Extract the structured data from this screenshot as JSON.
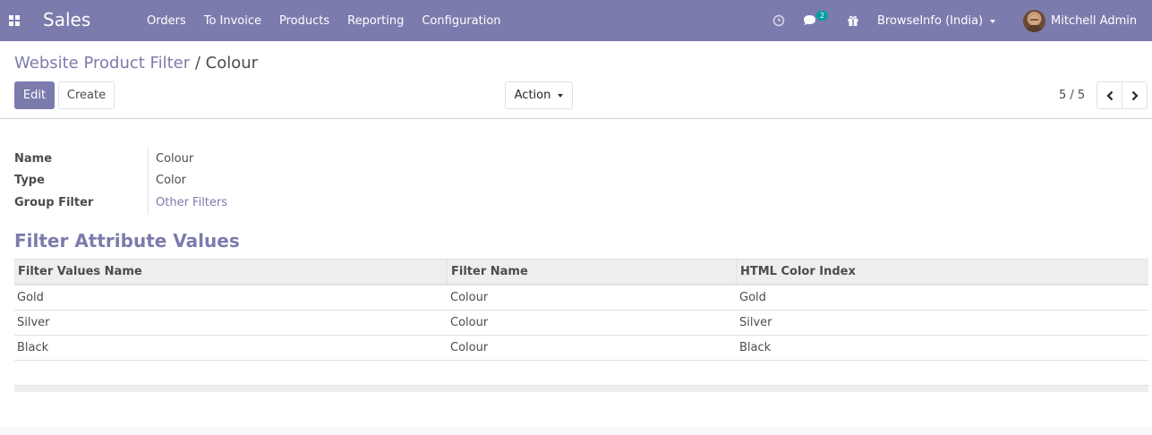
{
  "navbar": {
    "app_name": "Sales",
    "menu": [
      "Orders",
      "To Invoice",
      "Products",
      "Reporting",
      "Configuration"
    ],
    "messages_count": "2",
    "company": "BrowseInfo (India)",
    "user": "Mitchell Admin",
    "bg_color": "#7c7bad"
  },
  "breadcrumb": {
    "parent": "Website Product Filter",
    "separator": "/",
    "current": "Colour"
  },
  "buttons": {
    "edit": "Edit",
    "create": "Create",
    "action": "Action"
  },
  "pager": {
    "value": "5 / 5"
  },
  "form": {
    "fields": [
      {
        "label": "Name",
        "value": "Colour"
      },
      {
        "label": "Type",
        "value": "Color"
      },
      {
        "label": "Group Filter",
        "value": "Other Filters"
      }
    ]
  },
  "section": {
    "title": "Filter Attribute Values"
  },
  "table": {
    "columns": [
      "Filter Values Name",
      "Filter Name",
      "HTML Color Index"
    ],
    "rows": [
      [
        "Gold",
        "Colour",
        "Gold"
      ],
      [
        "Silver",
        "Colour",
        "Silver"
      ],
      [
        "Black",
        "Colour",
        "Black"
      ]
    ]
  },
  "icons": {
    "apps": "apps-grid-icon",
    "activity": "clock-icon",
    "messages": "chat-icon",
    "gift": "gift-icon",
    "prev": "chevron-left-icon",
    "next": "chevron-right-icon"
  },
  "accent_color": "#7c7bad"
}
